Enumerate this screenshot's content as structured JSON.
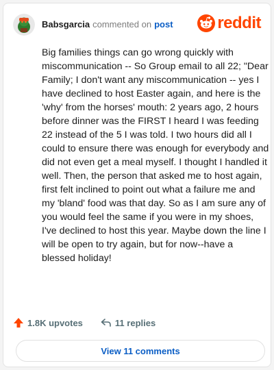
{
  "header": {
    "username": "Babsgarcia",
    "action_text": "commented on",
    "post_link_text": "post",
    "logo_text": "reddit"
  },
  "comment": {
    "body": "Big families things can go wrong quickly with miscommunication -- So Group email to all 22; \"Dear Family; I don't want any miscommunication -- yes I have declined to host Easter again, and here is the 'why' from the horses' mouth: 2 years ago, 2 hours before dinner was the FIRST I heard I was feeding 22 instead of the 5 I was told. I two hours did all I could to ensure there was enough for everybody and did not even get a meal myself. I thought I handled it well. Then, the person that asked me to host again, first felt inclined to point out what a failure me and my 'bland' food was that day. So as I am sure any of you would feel the same if you were in my shoes, I've declined to host this year. Maybe down the line I will be open to try again, but for now--have a blessed holiday!"
  },
  "actions": {
    "upvotes": "1.8K upvotes",
    "replies": "11 replies"
  },
  "footer": {
    "view_comments": "View 11 comments"
  },
  "colors": {
    "brand": "#ff4500",
    "link": "#0b5ec5",
    "muted": "#576f76"
  },
  "icons": {
    "avatar": "snoo-avatar-icon",
    "logo": "reddit-snoo-icon",
    "upvote": "upvote-arrow-icon",
    "reply": "reply-arrow-icon"
  }
}
